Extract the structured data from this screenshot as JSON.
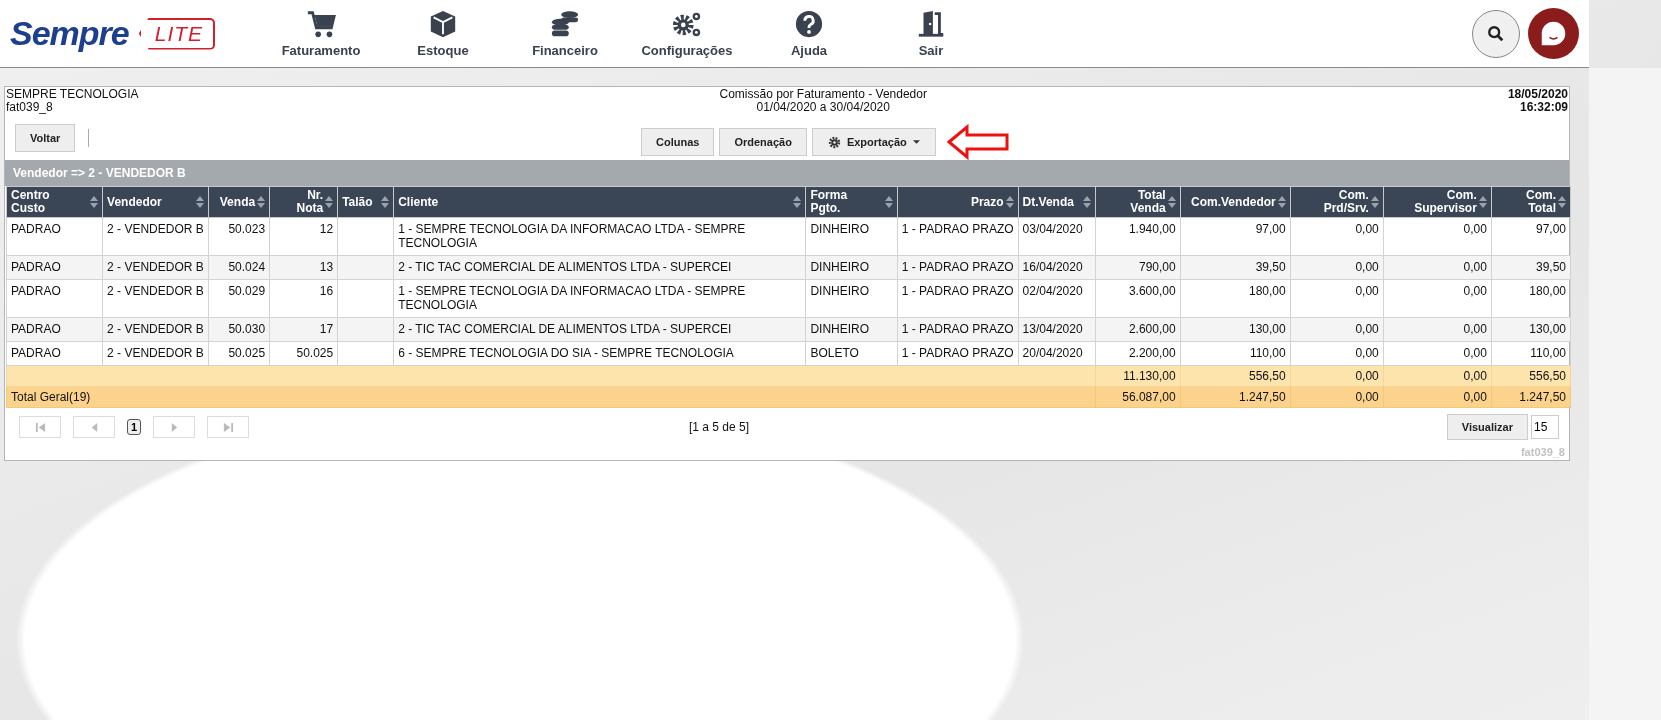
{
  "logo": {
    "brand": "Sempre",
    "tag": "LITE"
  },
  "nav": [
    {
      "kind": "cart",
      "label": "Faturamento"
    },
    {
      "kind": "box",
      "label": "Estoque"
    },
    {
      "kind": "coins",
      "label": "Financeiro"
    },
    {
      "kind": "gears",
      "label": "Configurações"
    },
    {
      "kind": "help",
      "label": "Ajuda"
    },
    {
      "kind": "exit",
      "label": "Sair"
    }
  ],
  "report": {
    "company": "SEMPRE TECNOLOGIA",
    "code": "fat039_8",
    "title": "Comissão por Faturamento - Vendedor",
    "period": "01/04/2020 a 30/04/2020",
    "date": "18/05/2020",
    "time": "16:32:09"
  },
  "toolbar": {
    "back": "Voltar",
    "buttons": [
      {
        "kind": "plain",
        "label": "Colunas"
      },
      {
        "kind": "plain",
        "label": "Ordenação"
      },
      {
        "kind": "menu",
        "label": "Exportação"
      }
    ]
  },
  "group_header": "Vendedor => 2 - VENDEDOR B",
  "table": {
    "columns": [
      {
        "label": "Centro\nCusto"
      },
      {
        "label": "Vendedor"
      },
      {
        "label": "Venda"
      },
      {
        "label": "Nr.\nNota"
      },
      {
        "label": "Talão"
      },
      {
        "label": "Cliente"
      },
      {
        "label": "Forma\nPgto."
      },
      {
        "label": "Prazo"
      },
      {
        "label": "Dt.Venda"
      },
      {
        "label": "Total\nVenda"
      },
      {
        "label": "Com.Vendedor"
      },
      {
        "label": "Com.\nPrd/Srv."
      },
      {
        "label": "Com.\nSupervisor"
      },
      {
        "label": "Com.\nTotal"
      }
    ],
    "rows": [
      [
        "PADRAO",
        "2 - VENDEDOR B",
        "50.023",
        "12",
        "",
        "1 - SEMPRE TECNOLOGIA DA INFORMACAO LTDA - SEMPRE TECNOLOGIA",
        "DINHEIRO",
        "1 - PADRAO PRAZO",
        "03/04/2020",
        "1.940,00",
        "97,00",
        "0,00",
        "0,00",
        "97,00"
      ],
      [
        "PADRAO",
        "2 - VENDEDOR B",
        "50.024",
        "13",
        "",
        "2 - TIC TAC COMERCIAL DE ALIMENTOS LTDA - SUPERCEI",
        "DINHEIRO",
        "1 - PADRAO PRAZO",
        "16/04/2020",
        "790,00",
        "39,50",
        "0,00",
        "0,00",
        "39,50"
      ],
      [
        "PADRAO",
        "2 - VENDEDOR B",
        "50.029",
        "16",
        "",
        "1 - SEMPRE TECNOLOGIA DA INFORMACAO LTDA - SEMPRE TECNOLOGIA",
        "DINHEIRO",
        "1 - PADRAO PRAZO",
        "02/04/2020",
        "3.600,00",
        "180,00",
        "0,00",
        "0,00",
        "180,00"
      ],
      [
        "PADRAO",
        "2 - VENDEDOR B",
        "50.030",
        "17",
        "",
        "2 - TIC TAC COMERCIAL DE ALIMENTOS LTDA - SUPERCEI",
        "DINHEIRO",
        "1 - PADRAO PRAZO",
        "13/04/2020",
        "2.600,00",
        "130,00",
        "0,00",
        "0,00",
        "130,00"
      ],
      [
        "PADRAO",
        "2 - VENDEDOR B",
        "50.025",
        "50.025",
        "",
        "6 - SEMPRE TECNOLOGIA DO SIA - SEMPRE TECNOLOGIA",
        "BOLETO",
        "1 - PADRAO PRAZO",
        "20/04/2020",
        "2.200,00",
        "110,00",
        "0,00",
        "0,00",
        "110,00"
      ]
    ],
    "subtotal": [
      "11.130,00",
      "556,50",
      "0,00",
      "0,00",
      "556,50"
    ],
    "total": {
      "label": "Total Geral(19)",
      "values": [
        "56.087,00",
        "1.247,50",
        "0,00",
        "0,00",
        "1.247,50"
      ]
    }
  },
  "pager": {
    "pages": [
      {
        "label": "1",
        "selected": true
      }
    ],
    "summary": "[1 a 5 de 5]",
    "view_button": "Visualizar",
    "page_size": "15"
  },
  "footer_code": "fat039_8"
}
